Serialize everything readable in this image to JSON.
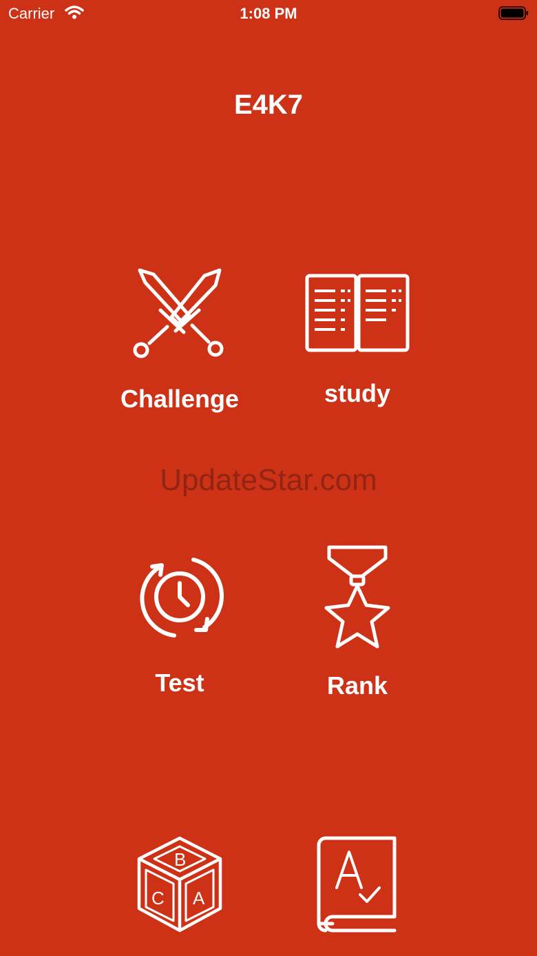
{
  "status_bar": {
    "carrier": "Carrier",
    "time": "1:08 PM",
    "icons": [
      "wifi-icon",
      "battery-icon"
    ]
  },
  "app": {
    "title": "E4K7",
    "background_color": "#CE3216",
    "foreground_color": "#FFFFFF"
  },
  "menu": {
    "items": [
      {
        "label": "Challenge",
        "icon": "crossed-swords-icon"
      },
      {
        "label": "study",
        "icon": "open-book-icon"
      },
      {
        "label": "Test",
        "icon": "timer-refresh-icon"
      },
      {
        "label": "Rank",
        "icon": "medal-star-icon"
      },
      {
        "label": "",
        "icon": "abc-block-icon"
      },
      {
        "label": "",
        "icon": "spelling-book-icon"
      }
    ]
  },
  "watermark": "UpdateStar.com"
}
